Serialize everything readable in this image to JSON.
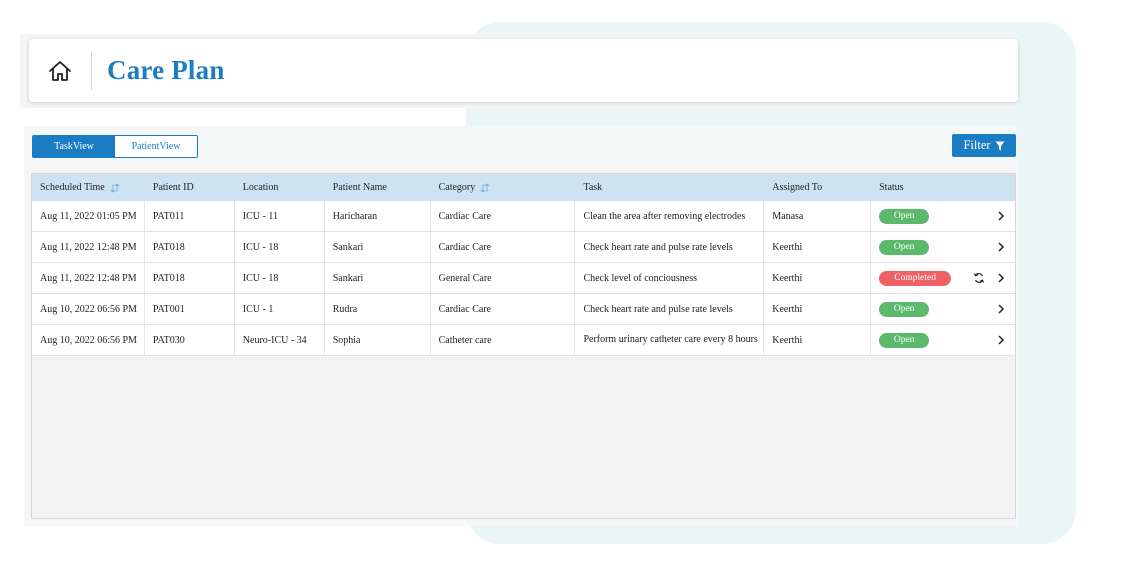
{
  "header": {
    "title": "Care Plan"
  },
  "view_toggle": {
    "task_view": "TaskView",
    "patient_view": "PatientView"
  },
  "filter": {
    "label": "Filter"
  },
  "table": {
    "columns": [
      "Scheduled Time",
      "Patient ID",
      "Location",
      "Patient Name",
      "Category",
      "Task",
      "Assigned To",
      "Status"
    ],
    "rows": [
      {
        "time": "Aug 11, 2022 01:05 PM",
        "pid": "PAT011",
        "location": "ICU - 11",
        "name": "Haricharan",
        "category": "Cardiac Care",
        "task": "Clean the area after removing electrodes",
        "assigned": "Manasa",
        "status": "Open"
      },
      {
        "time": "Aug 11, 2022 12:48 PM",
        "pid": "PAT018",
        "location": "ICU - 18",
        "name": "Sankari",
        "category": "Cardiac Care",
        "task": "Check heart rate and pulse rate levels",
        "assigned": "Keerthi",
        "status": "Open"
      },
      {
        "time": "Aug 11, 2022 12:48 PM",
        "pid": "PAT018",
        "location": "ICU - 18",
        "name": "Sankari",
        "category": "General Care",
        "task": "Check level of conciousness",
        "assigned": "Keerthi",
        "status": "Completed"
      },
      {
        "time": "Aug 10, 2022 06:56 PM",
        "pid": "PAT001",
        "location": "ICU - 1",
        "name": "Rudra",
        "category": "Cardiac Care",
        "task": "Check heart rate and pulse rate levels",
        "assigned": "Keerthi",
        "status": "Open"
      },
      {
        "time": "Aug 10, 2022 06:56 PM",
        "pid": "PAT030",
        "location": "Neuro-ICU - 34",
        "name": "Sophia",
        "category": "Catheter care",
        "task": "Perform urinary catheter care every 8 hours",
        "assigned": "Keerthi",
        "status": "Open"
      }
    ]
  },
  "colors": {
    "accent": "#1a7cc2",
    "header_row": "#cde3f2",
    "open_badge": "#5cb86a",
    "completed_badge": "#ee6164",
    "background_shape": "#eaf6f5"
  }
}
